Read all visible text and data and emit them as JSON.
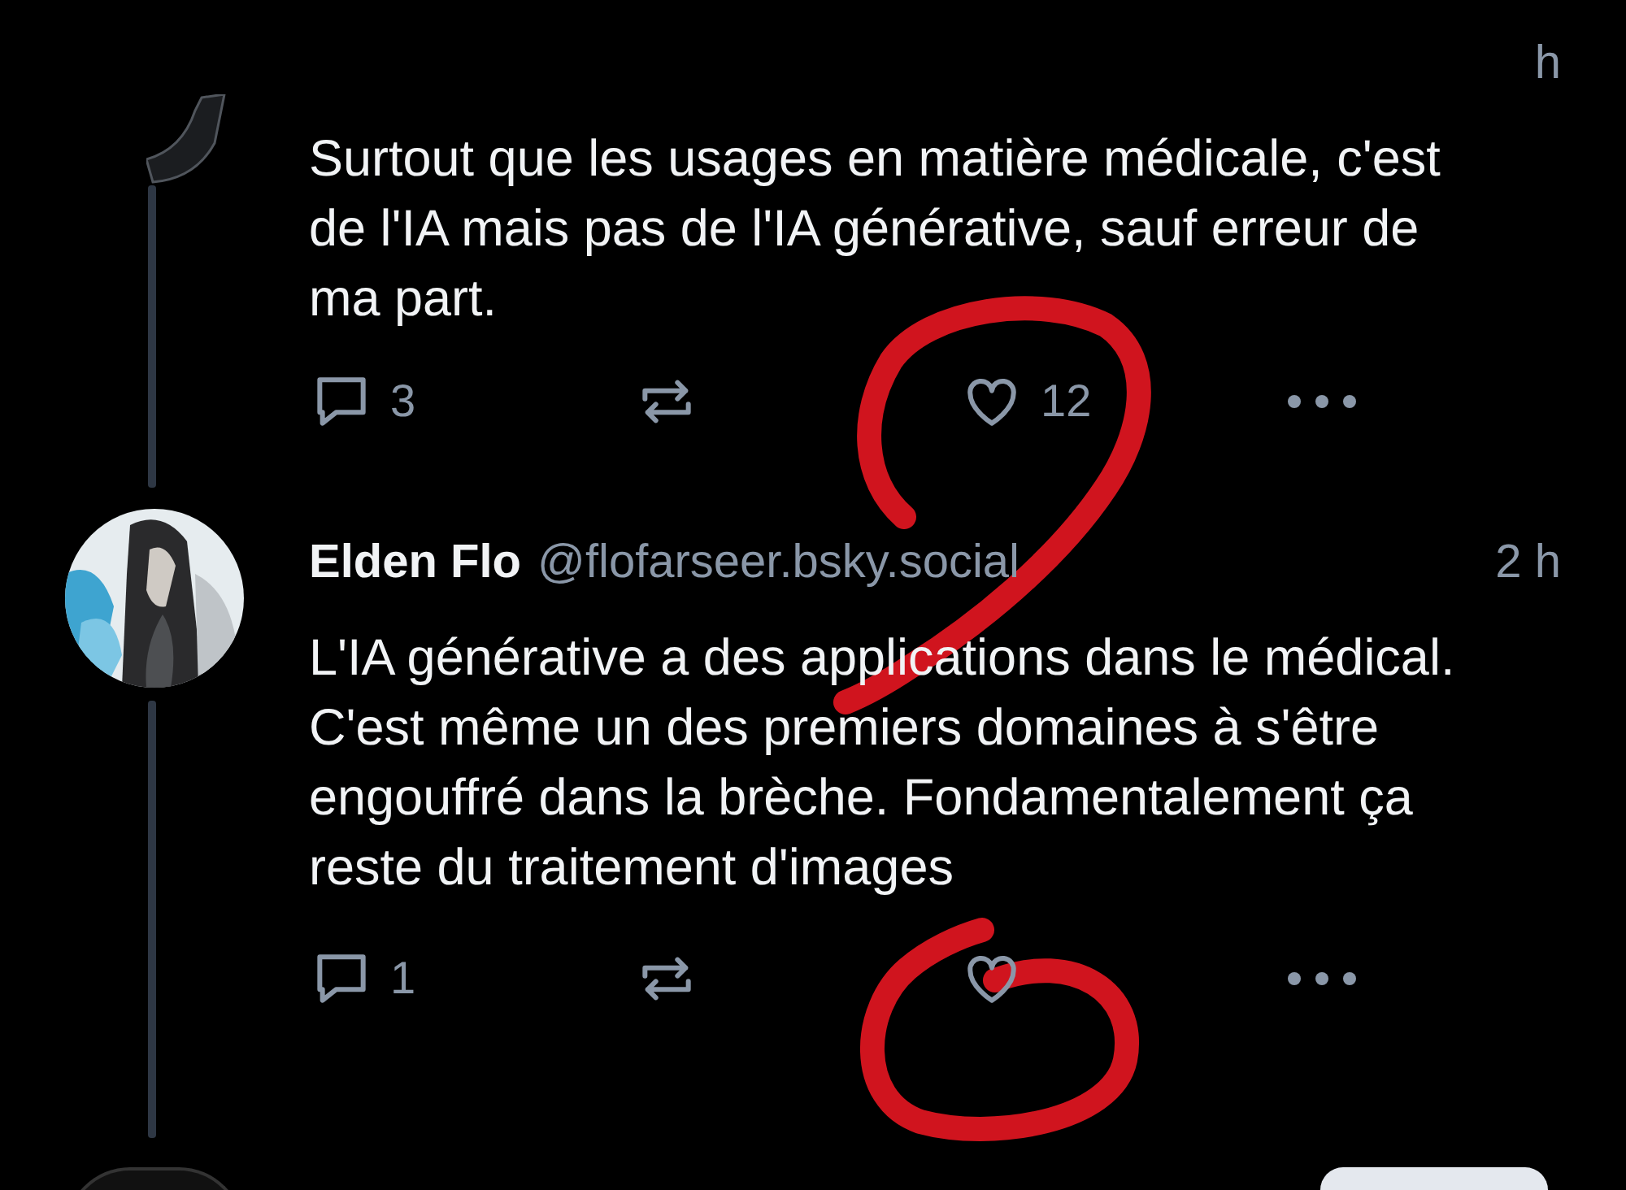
{
  "posts": [
    {
      "time": "h",
      "text": "Surtout que les usages en matière médicale, c'est de l'IA mais pas de l'IA générative, sauf erreur de ma part.",
      "replies": "3",
      "likes": "12",
      "liked": false,
      "avatar": {
        "kind": "fragment"
      }
    },
    {
      "author": "Elden Flo",
      "handle": "@flofarseer.bsky.social",
      "time": "2 h",
      "text": "L'IA générative a des applications dans le médical. C'est même un des premiers domaines à s'être engouffré dans la brèche. Fondamentalement ça reste du traitement d'images",
      "replies": "1",
      "liked": false
    }
  ]
}
